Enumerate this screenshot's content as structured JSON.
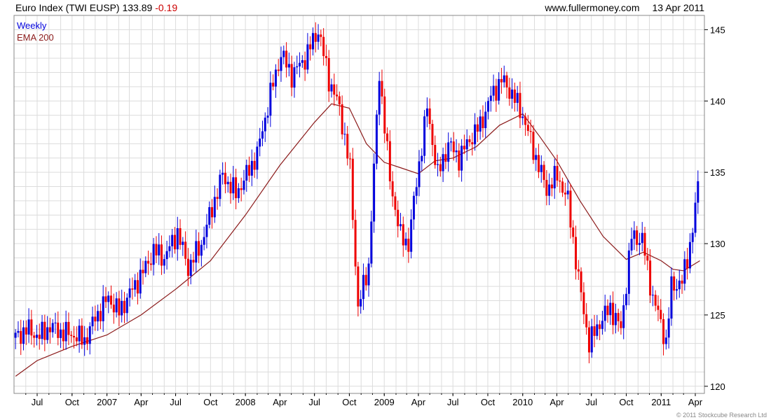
{
  "header": {
    "title": "Euro Index (TWI EUSP)",
    "last": "133.89",
    "change": "-0.19",
    "site": "www.fullermoney.com",
    "date": "13 Apr 2011"
  },
  "copyright": "© 2011 Stockcube Research Ltd",
  "colors": {
    "up": "#0000dd",
    "down": "#ee0000",
    "ema": "#8b1a1a",
    "grid": "#dcdcdc",
    "frame": "#888888"
  },
  "chart_data": {
    "type": "candlestick",
    "legend": [
      "Weekly",
      "EMA 200"
    ],
    "legend_position": "top-left",
    "ylim": [
      119.5,
      146.0
    ],
    "y_ticks": [
      120,
      125,
      130,
      135,
      140,
      145
    ],
    "x_range": [
      "2006-05-01",
      "2011-04-25"
    ],
    "x_ticks": [
      {
        "label": "Jul",
        "date": "2006-07-01"
      },
      {
        "label": "Oct",
        "date": "2006-10-01"
      },
      {
        "label": "2007",
        "date": "2007-01-01"
      },
      {
        "label": "Apr",
        "date": "2007-04-01"
      },
      {
        "label": "Jul",
        "date": "2007-07-01"
      },
      {
        "label": "Oct",
        "date": "2007-10-01"
      },
      {
        "label": "2008",
        "date": "2008-01-01"
      },
      {
        "label": "Apr",
        "date": "2008-04-01"
      },
      {
        "label": "Jul",
        "date": "2008-07-01"
      },
      {
        "label": "Oct",
        "date": "2008-10-01"
      },
      {
        "label": "2009",
        "date": "2009-01-01"
      },
      {
        "label": "Apr",
        "date": "2009-04-01"
      },
      {
        "label": "Jul",
        "date": "2009-07-01"
      },
      {
        "label": "Oct",
        "date": "2009-10-01"
      },
      {
        "label": "2010",
        "date": "2010-01-01"
      },
      {
        "label": "Apr",
        "date": "2010-04-01"
      },
      {
        "label": "Jul",
        "date": "2010-07-01"
      },
      {
        "label": "Oct",
        "date": "2010-10-01"
      },
      {
        "label": "2011",
        "date": "2011-01-01"
      },
      {
        "label": "Apr",
        "date": "2011-04-01"
      }
    ],
    "grid": true,
    "close_series": [
      {
        "date": "2006-05-05",
        "close": 123.4
      },
      {
        "date": "2006-06-02",
        "close": 124.0
      },
      {
        "date": "2006-07-07",
        "close": 123.5
      },
      {
        "date": "2006-08-04",
        "close": 124.2
      },
      {
        "date": "2006-09-01",
        "close": 123.8
      },
      {
        "date": "2006-10-06",
        "close": 123.6
      },
      {
        "date": "2006-11-03",
        "close": 123.2
      },
      {
        "date": "2006-12-01",
        "close": 124.8
      },
      {
        "date": "2007-01-05",
        "close": 126.2
      },
      {
        "date": "2007-02-02",
        "close": 125.2
      },
      {
        "date": "2007-03-02",
        "close": 126.5
      },
      {
        "date": "2007-04-06",
        "close": 128.0
      },
      {
        "date": "2007-05-04",
        "close": 129.5
      },
      {
        "date": "2007-06-01",
        "close": 129.0
      },
      {
        "date": "2007-07-06",
        "close": 130.8
      },
      {
        "date": "2007-08-03",
        "close": 128.3
      },
      {
        "date": "2007-09-07",
        "close": 130.0
      },
      {
        "date": "2007-10-05",
        "close": 132.5
      },
      {
        "date": "2007-11-02",
        "close": 134.8
      },
      {
        "date": "2007-12-07",
        "close": 133.5
      },
      {
        "date": "2008-01-04",
        "close": 134.8
      },
      {
        "date": "2008-02-01",
        "close": 136.3
      },
      {
        "date": "2008-03-07",
        "close": 140.5
      },
      {
        "date": "2008-04-04",
        "close": 143.3
      },
      {
        "date": "2008-05-02",
        "close": 141.8
      },
      {
        "date": "2008-06-06",
        "close": 143.0
      },
      {
        "date": "2008-07-11",
        "close": 145.0
      },
      {
        "date": "2008-08-08",
        "close": 141.5
      },
      {
        "date": "2008-09-05",
        "close": 139.5
      },
      {
        "date": "2008-10-03",
        "close": 135.2
      },
      {
        "date": "2008-10-24",
        "close": 125.5
      },
      {
        "date": "2008-11-21",
        "close": 128.5
      },
      {
        "date": "2008-12-19",
        "close": 142.0
      },
      {
        "date": "2009-01-16",
        "close": 134.5
      },
      {
        "date": "2009-02-13",
        "close": 130.5
      },
      {
        "date": "2009-03-06",
        "close": 130.0
      },
      {
        "date": "2009-03-27",
        "close": 134.3
      },
      {
        "date": "2009-04-24",
        "close": 139.5
      },
      {
        "date": "2009-05-22",
        "close": 134.8
      },
      {
        "date": "2009-06-19",
        "close": 137.0
      },
      {
        "date": "2009-07-17",
        "close": 136.0
      },
      {
        "date": "2009-08-14",
        "close": 137.3
      },
      {
        "date": "2009-09-11",
        "close": 138.3
      },
      {
        "date": "2009-10-09",
        "close": 140.3
      },
      {
        "date": "2009-11-06",
        "close": 141.5
      },
      {
        "date": "2009-12-04",
        "close": 140.5
      },
      {
        "date": "2010-01-01",
        "close": 139.0
      },
      {
        "date": "2010-02-05",
        "close": 136.0
      },
      {
        "date": "2010-03-05",
        "close": 133.8
      },
      {
        "date": "2010-04-02",
        "close": 134.8
      },
      {
        "date": "2010-04-30",
        "close": 133.0
      },
      {
        "date": "2010-05-28",
        "close": 127.5
      },
      {
        "date": "2010-06-25",
        "close": 123.0
      },
      {
        "date": "2010-07-23",
        "close": 124.5
      },
      {
        "date": "2010-08-20",
        "close": 125.5
      },
      {
        "date": "2010-09-17",
        "close": 124.0
      },
      {
        "date": "2010-10-15",
        "close": 130.5
      },
      {
        "date": "2010-11-12",
        "close": 130.3
      },
      {
        "date": "2010-12-10",
        "close": 126.2
      },
      {
        "date": "2010-12-31",
        "close": 124.5
      },
      {
        "date": "2011-01-14",
        "close": 123.0
      },
      {
        "date": "2011-01-28",
        "close": 127.0
      },
      {
        "date": "2011-02-25",
        "close": 127.3
      },
      {
        "date": "2011-03-11",
        "close": 129.0
      },
      {
        "date": "2011-03-25",
        "close": 131.0
      },
      {
        "date": "2011-04-08",
        "close": 134.0
      },
      {
        "date": "2011-04-13",
        "close": 133.89
      }
    ],
    "ema_series": [
      {
        "date": "2006-05-05",
        "value": 120.7
      },
      {
        "date": "2006-07-01",
        "value": 121.8
      },
      {
        "date": "2006-10-01",
        "value": 122.8
      },
      {
        "date": "2007-01-01",
        "value": 123.6
      },
      {
        "date": "2007-04-01",
        "value": 125.0
      },
      {
        "date": "2007-07-01",
        "value": 126.8
      },
      {
        "date": "2007-10-01",
        "value": 128.8
      },
      {
        "date": "2008-01-01",
        "value": 132.0
      },
      {
        "date": "2008-04-01",
        "value": 135.5
      },
      {
        "date": "2008-07-01",
        "value": 138.5
      },
      {
        "date": "2008-08-15",
        "value": 139.8
      },
      {
        "date": "2008-10-01",
        "value": 139.5
      },
      {
        "date": "2008-11-15",
        "value": 137.0
      },
      {
        "date": "2009-01-01",
        "value": 135.7
      },
      {
        "date": "2009-02-15",
        "value": 135.3
      },
      {
        "date": "2009-04-01",
        "value": 134.9
      },
      {
        "date": "2009-05-15",
        "value": 135.8
      },
      {
        "date": "2009-07-01",
        "value": 136.0
      },
      {
        "date": "2009-09-01",
        "value": 136.8
      },
      {
        "date": "2009-11-01",
        "value": 138.3
      },
      {
        "date": "2010-01-01",
        "value": 139.1
      },
      {
        "date": "2010-02-15",
        "value": 137.5
      },
      {
        "date": "2010-04-01",
        "value": 135.8
      },
      {
        "date": "2010-06-01",
        "value": 133.0
      },
      {
        "date": "2010-08-01",
        "value": 130.5
      },
      {
        "date": "2010-10-01",
        "value": 128.9
      },
      {
        "date": "2010-11-15",
        "value": 129.4
      },
      {
        "date": "2011-01-01",
        "value": 128.8
      },
      {
        "date": "2011-02-01",
        "value": 128.2
      },
      {
        "date": "2011-03-01",
        "value": 128.1
      },
      {
        "date": "2011-04-13",
        "value": 128.8
      }
    ]
  }
}
